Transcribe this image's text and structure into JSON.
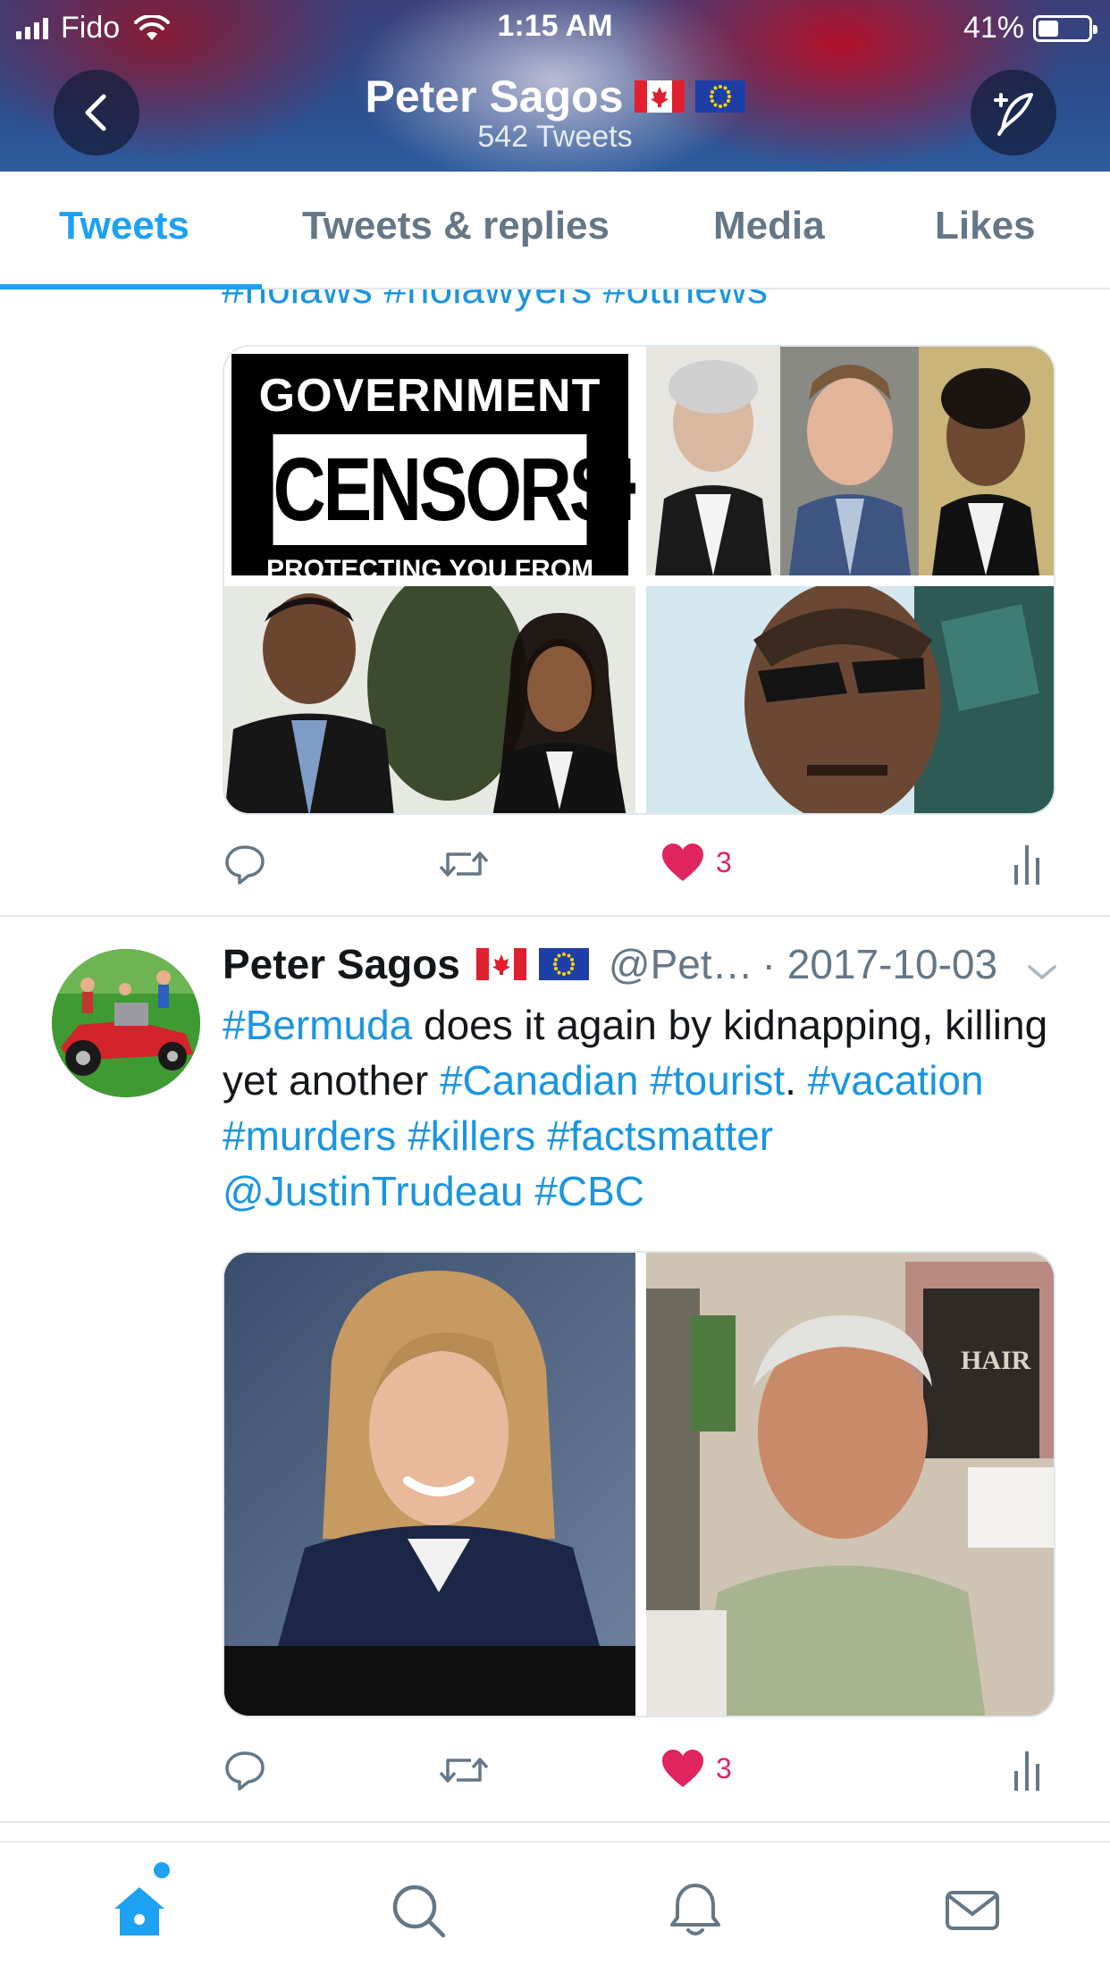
{
  "status_bar": {
    "carrier": "Fido",
    "time": "1:15 AM",
    "battery_percent": "41%",
    "battery_level": 0.41
  },
  "header": {
    "profile_name": "Peter Sagos",
    "tweet_count": "542 Tweets",
    "back_icon": "chevron-left-icon",
    "compose_icon": "compose-feather-icon"
  },
  "tabs": [
    {
      "label": "Tweets",
      "active": true
    },
    {
      "label": "Tweets & replies",
      "active": false
    },
    {
      "label": "Media",
      "active": false
    },
    {
      "label": "Likes",
      "active": false
    }
  ],
  "feed": {
    "cut_off_text": "#rlolaws #rlolawyers #ottnews",
    "tweet1": {
      "photo1_text": {
        "line1": "GOVERNMENT",
        "line2": "CENSORSHIP",
        "line3": "PROTECTING YOU FROM REALITY"
      },
      "like_count": "3",
      "liked": true
    },
    "tweet2": {
      "name": "Peter Sagos",
      "handle": "@Pet…",
      "date": "· 2017-10-03",
      "text_segments": [
        {
          "text": "#Bermuda",
          "type": "hashtag"
        },
        {
          "text": " does it again by kidnapping, killing yet another ",
          "type": "plain"
        },
        {
          "text": "#Canadian",
          "type": "hashtag"
        },
        {
          "text": " ",
          "type": "plain"
        },
        {
          "text": "#tourist",
          "type": "hashtag"
        },
        {
          "text": ". ",
          "type": "plain"
        },
        {
          "text": "#vacation",
          "type": "hashtag"
        },
        {
          "text": " ",
          "type": "plain"
        },
        {
          "text": "#murders",
          "type": "hashtag"
        },
        {
          "text": " ",
          "type": "plain"
        },
        {
          "text": "#killers",
          "type": "hashtag"
        },
        {
          "text": " ",
          "type": "plain"
        },
        {
          "text": "#factsmatter",
          "type": "hashtag"
        },
        {
          "text": " ",
          "type": "plain"
        },
        {
          "text": "@JustinTrudeau",
          "type": "hashtag"
        },
        {
          "text": " ",
          "type": "plain"
        },
        {
          "text": "#CBC",
          "type": "hashtag"
        }
      ],
      "photo2_sign": "HAIR",
      "like_count": "3",
      "liked": true
    }
  },
  "bottom_nav": [
    {
      "icon": "home-icon",
      "active": true
    },
    {
      "icon": "search-icon",
      "active": false
    },
    {
      "icon": "notifications-bell-icon",
      "active": false
    },
    {
      "icon": "messages-envelope-icon",
      "active": false
    }
  ],
  "colors": {
    "accent": "#1da1f2",
    "link": "#1b95e0",
    "like": "#e0245e",
    "muted": "#657786"
  }
}
